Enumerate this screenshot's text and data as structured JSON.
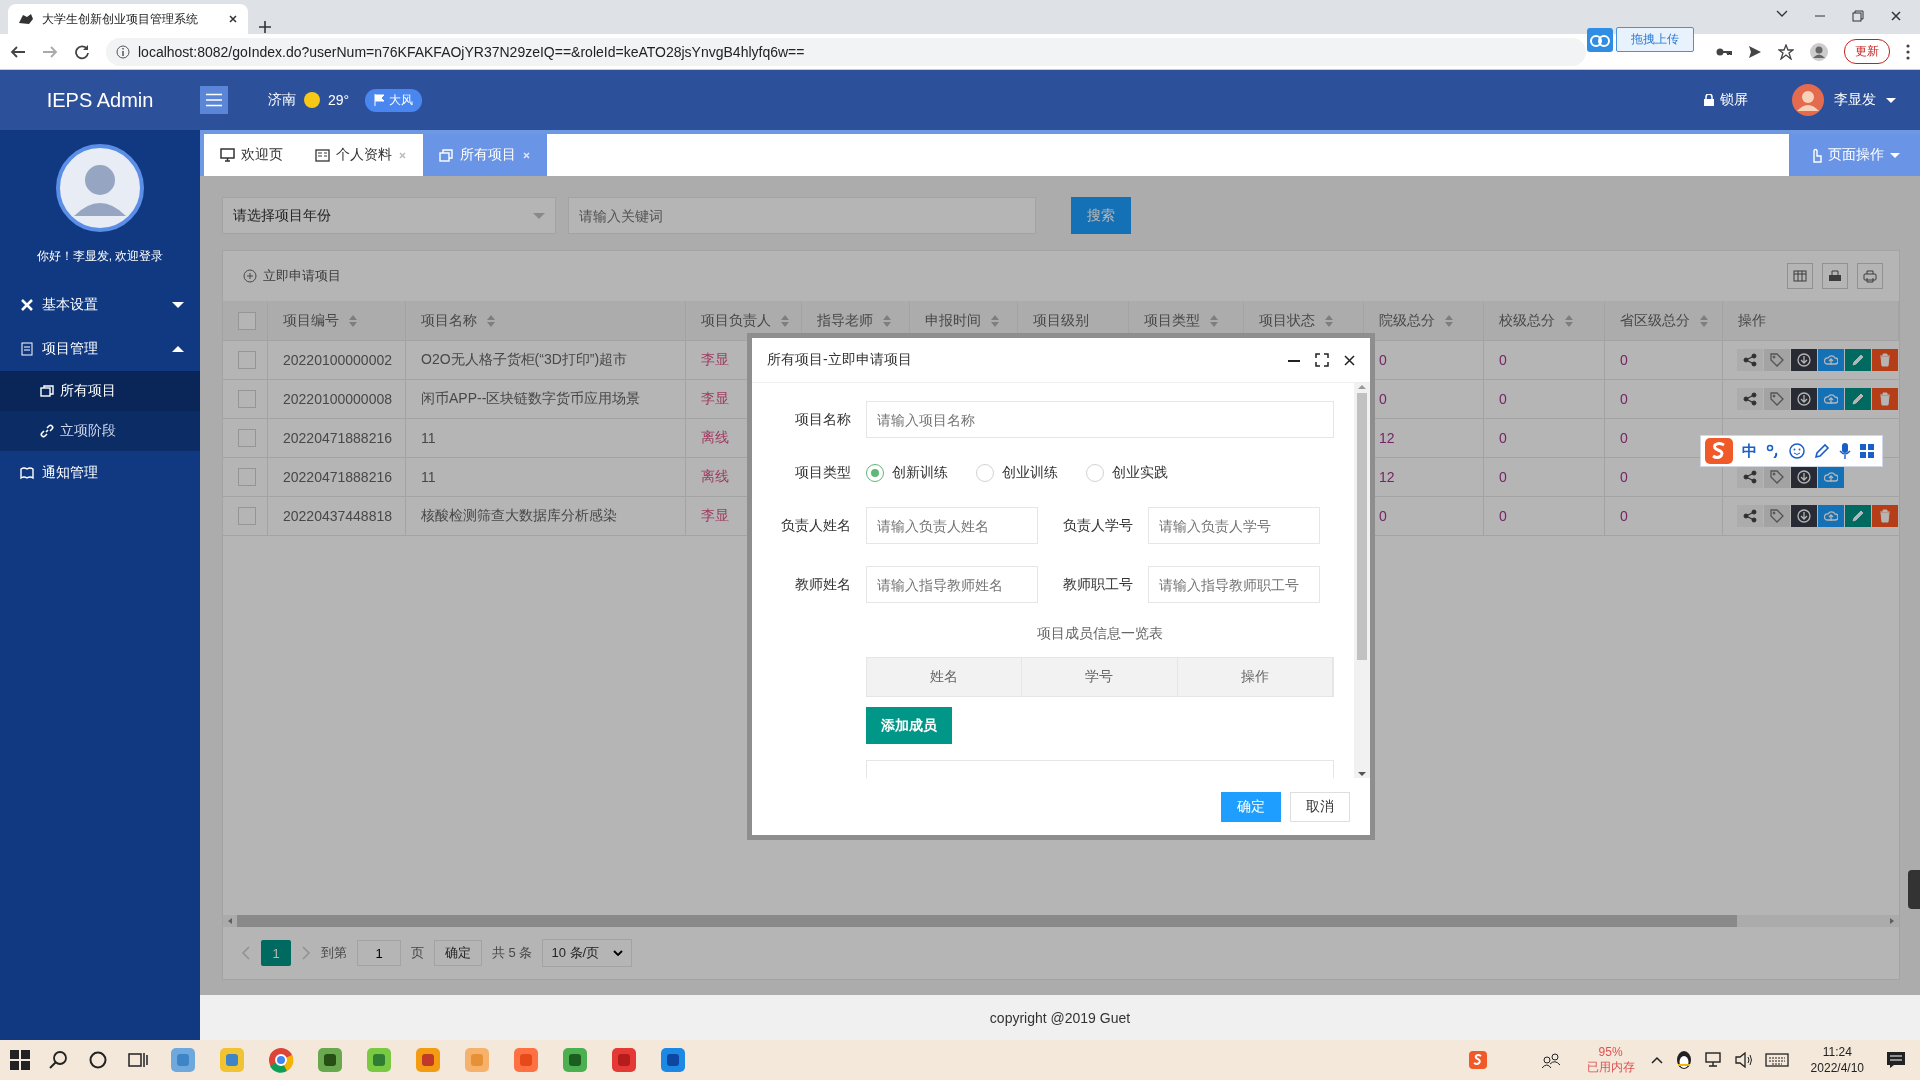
{
  "browser": {
    "tab_title": "大学生创新创业项目管理系统",
    "address": "localhost:8082/goIndex.do?userNum=n76KFAKFAOjYR37N29zeIQ==&roleId=keATO28jsYnvgB4hlyfq6w==",
    "extension_button": "拖拽上传",
    "update_button": "更新"
  },
  "header": {
    "logo": "IEPS Admin",
    "city": "济南",
    "temperature": "29°",
    "weather_badge": "大风",
    "lock_label": "锁屏",
    "user_name": "李显发"
  },
  "sidebar": {
    "greeting": "你好！李显发, 欢迎登录",
    "items": [
      {
        "label": "基本设置",
        "expanded": false
      },
      {
        "label": "项目管理",
        "expanded": true,
        "children": [
          {
            "label": "所有项目",
            "selected": true
          },
          {
            "label": "立项阶段",
            "selected": false
          }
        ]
      },
      {
        "label": "通知管理"
      }
    ]
  },
  "tabs": [
    {
      "label": "欢迎页",
      "selected": false,
      "closable": false
    },
    {
      "label": "个人资料",
      "selected": false,
      "closable": true
    },
    {
      "label": "所有项目",
      "selected": true,
      "closable": true
    }
  ],
  "page_ops": "页面操作",
  "filters": {
    "year_placeholder": "请选择项目年份",
    "keyword_placeholder": "请输入关键词",
    "search_button": "搜索"
  },
  "table": {
    "add_link": "立即申请项目",
    "header_checked": false,
    "columns": [
      {
        "label": "项目编号",
        "sortable": true
      },
      {
        "label": "项目名称",
        "sortable": true
      },
      {
        "label": "项目负责人",
        "sortable": true
      },
      {
        "label": "指导老师",
        "sortable": true
      },
      {
        "label": "申报时间",
        "sortable": true
      },
      {
        "label": "项目级别",
        "sortable": false
      },
      {
        "label": "项目类型",
        "sortable": true
      },
      {
        "label": "项目状态",
        "sortable": true
      },
      {
        "label": "院级总分",
        "sortable": true
      },
      {
        "label": "校级总分",
        "sortable": true
      },
      {
        "label": "省区级总分",
        "sortable": true
      },
      {
        "label": "操作",
        "sortable": false
      }
    ],
    "rows": [
      {
        "checked": false,
        "id": "20220100000002",
        "name": "O2O无人格子货柜(“3D打印”)超市",
        "leader": "李显",
        "college_score": "0",
        "school_score": "0",
        "province_score": "0",
        "actions": [
          {
            "kind": "share"
          },
          {
            "kind": "tag"
          },
          {
            "kind": "download"
          },
          {
            "kind": "upload"
          },
          {
            "kind": "edit"
          },
          {
            "kind": "delete"
          }
        ]
      },
      {
        "checked": false,
        "id": "20220100000008",
        "name": "闲币APP--区块链数字货币应用场景",
        "leader": "李显",
        "college_score": "0",
        "school_score": "0",
        "province_score": "0",
        "actions": [
          {
            "kind": "share"
          },
          {
            "kind": "tag"
          },
          {
            "kind": "download"
          },
          {
            "kind": "upload"
          },
          {
            "kind": "edit"
          },
          {
            "kind": "delete"
          }
        ]
      },
      {
        "checked": false,
        "id": "20220471888216",
        "name": "11",
        "leader": "离线",
        "college_score": "12",
        "school_score": "0",
        "province_score": "0"
      },
      {
        "checked": false,
        "id": "20220471888216",
        "name": "11",
        "leader": "离线",
        "college_score": "12",
        "school_score": "0",
        "province_score": "0",
        "actions": [
          {
            "kind": "share"
          },
          {
            "kind": "tag"
          },
          {
            "kind": "download"
          },
          {
            "kind": "upload"
          }
        ]
      },
      {
        "checked": false,
        "id": "20220437448818",
        "name": "核酸检测筛查大数据库分析感染",
        "leader": "李显",
        "college_score": "0",
        "school_score": "0",
        "province_score": "0",
        "actions": [
          {
            "kind": "share"
          },
          {
            "kind": "tag"
          },
          {
            "kind": "download"
          },
          {
            "kind": "upload"
          },
          {
            "kind": "edit"
          },
          {
            "kind": "delete"
          }
        ]
      }
    ]
  },
  "pagination": {
    "current": "1",
    "goto_label": "到第",
    "page_input": "1",
    "page_unit": "页",
    "confirm": "确定",
    "total": "共 5 条",
    "page_size": "10 条/页"
  },
  "footer": "copyright @2019 Guet",
  "modal": {
    "title": "所有项目-立即申请项目",
    "project_name": {
      "label": "项目名称",
      "placeholder": "请输入项目名称"
    },
    "project_type": {
      "label": "项目类型",
      "options": [
        {
          "label": "创新训练",
          "selected": true
        },
        {
          "label": "创业训练",
          "selected": false
        },
        {
          "label": "创业实践",
          "selected": false
        }
      ]
    },
    "leader_name": {
      "label": "负责人姓名",
      "placeholder": "请输入负责人姓名"
    },
    "leader_id": {
      "label": "负责人学号",
      "placeholder": "请输入负责人学号"
    },
    "teacher_name": {
      "label": "教师姓名",
      "placeholder": "请输入指导教师姓名"
    },
    "teacher_id": {
      "label": "教师职工号",
      "placeholder": "请输入指导教师职工号"
    },
    "members_title": "项目成员信息一览表",
    "member_columns": [
      "姓名",
      "学号",
      "操作"
    ],
    "add_member_button": "添加成员",
    "buttons": [
      {
        "label": "确定",
        "kind": "primary"
      },
      {
        "label": "取消",
        "kind": "default"
      }
    ]
  },
  "ime_toolbar": {
    "mode": "中"
  },
  "taskbar": {
    "memory_percent": "95%",
    "memory_label": "已用内存",
    "time": "11:24",
    "date": "2022/4/10"
  }
}
